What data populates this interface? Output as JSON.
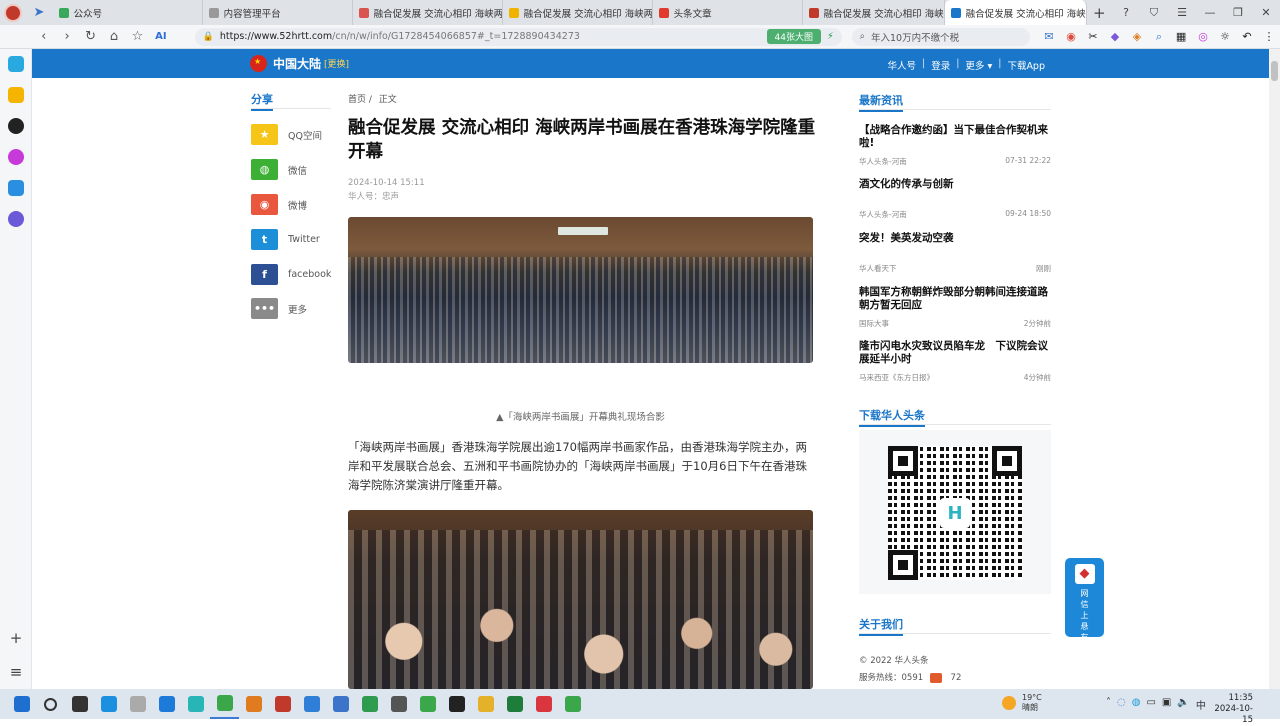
{
  "browser": {
    "tabs": [
      {
        "label": "公众号",
        "color": "#3aa85a"
      },
      {
        "label": "内容管理平台",
        "color": "#999999"
      },
      {
        "label": "融合促发展 交流心相印 海峡两",
        "color": "#d9534f"
      },
      {
        "label": "融合促发展 交流心相印 海峡两",
        "color": "#f0b400"
      },
      {
        "label": "头条文章",
        "color": "#e03b2d"
      },
      {
        "label": "融合促发展 交流心相印 海峡两",
        "color": "#c0392b"
      },
      {
        "label": "融合促发展 交流心相印 海峡两",
        "color": "#1976c8"
      }
    ],
    "url_host": "https://www.52hrtt.com",
    "url_path": "/cn/n/w/info/G1728454066857#_t=1728890434273",
    "url_badge": "44张大图",
    "search_placeholder": "年入10万内不缴个税"
  },
  "site": {
    "region": "中国大陆",
    "change": "[更换]",
    "nav": [
      "华人号",
      "登录",
      "更多",
      "下载App"
    ]
  },
  "share": {
    "title": "分享",
    "items": [
      {
        "label": "QQ空间",
        "color": "#f5c518",
        "glyph": "★"
      },
      {
        "label": "微信",
        "color": "#3cb034",
        "glyph": "◍"
      },
      {
        "label": "微博",
        "color": "#e9573f",
        "glyph": "◉"
      },
      {
        "label": "Twitter",
        "color": "#1d8fd8",
        "glyph": "t"
      },
      {
        "label": "facebook",
        "color": "#2d4f93",
        "glyph": "f"
      },
      {
        "label": "更多",
        "color": "#8a8a8a",
        "glyph": "•••"
      }
    ]
  },
  "article": {
    "breadcrumb": [
      "首页",
      "正文"
    ],
    "title": "融合促发展 交流心相印 海峡两岸书画展在香港珠海学院隆重开幕",
    "date": "2024-10-14 15:11",
    "author": "华人号：忠声",
    "caption": "▲「海峡两岸书画展」开幕典礼现场合影",
    "paragraph": "「海峡两岸书画展」香港珠海学院展出逾170幅两岸书画家作品，由香港珠海学院主办，两岸和平发展联合总会、五洲和平书画院协办的「海峡两岸书画展」于10月6日下午在香港珠海学院陈济棠演讲厅隆重开幕。"
  },
  "sidebar": {
    "latest_title": "最新资讯",
    "news": [
      {
        "title": "【战略合作邀约函】当下最佳合作契机来啦!",
        "source": "华人头条-河南",
        "time": "07-31 22:22"
      },
      {
        "title": "酒文化的传承与创新",
        "source": "华人头条-河南",
        "time": "09-24 18:50"
      },
      {
        "title": "突发！美英发动空袭",
        "source": "华人看天下",
        "time": "刚刚"
      },
      {
        "title": "韩国军方称朝鲜炸毁部分朝韩间连接道路 朝方暂无回应",
        "source": "国际大事",
        "time": "2分钟前"
      },
      {
        "title": "隆市闪电水灾致议员陷车龙　下议院会议展延半小时",
        "source": "马来西亚《东方日报》",
        "time": "4分钟前"
      }
    ],
    "download_title": "下载华人头条",
    "about_title": "关于我们",
    "copyright": "© 2022 华人头条",
    "hotline": "服务热线：0591",
    "hotline_tail": "72",
    "float_label": "网信上悬有举报"
  },
  "taskbar": {
    "weather_temp": "19°C",
    "weather_desc": "晴朗",
    "time": "11:35",
    "date": "2024-10-15"
  }
}
